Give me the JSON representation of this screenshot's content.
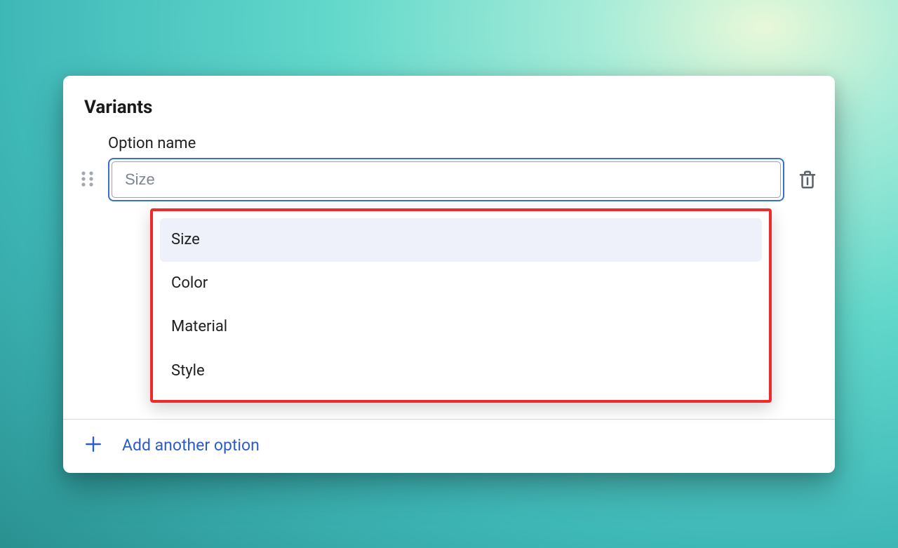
{
  "section": {
    "title": "Variants"
  },
  "option": {
    "label": "Option name",
    "placeholder": "Size",
    "value": ""
  },
  "dropdown": {
    "items": [
      {
        "label": "Size",
        "highlighted": true
      },
      {
        "label": "Color",
        "highlighted": false
      },
      {
        "label": "Material",
        "highlighted": false
      },
      {
        "label": "Style",
        "highlighted": false
      }
    ]
  },
  "footer": {
    "add_label": "Add another option"
  }
}
